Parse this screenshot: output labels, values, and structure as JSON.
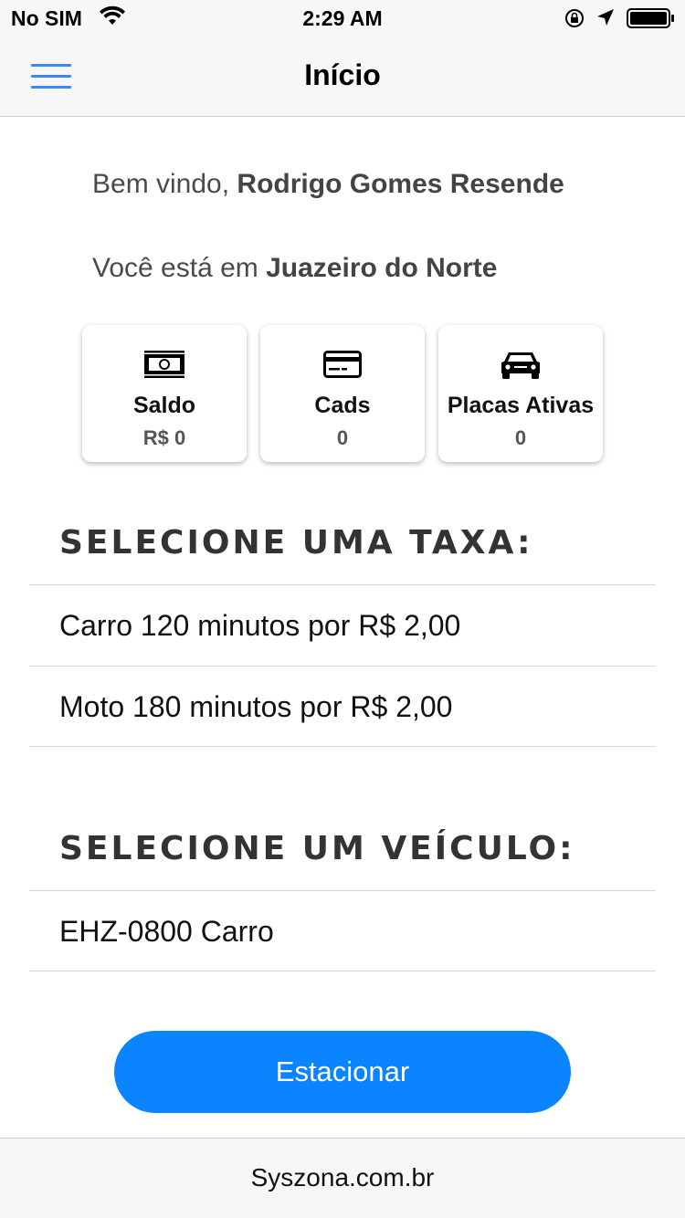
{
  "status_bar": {
    "carrier": "No SIM",
    "time": "2:29 AM"
  },
  "nav": {
    "title": "Início",
    "menu_icon": "hamburger-icon"
  },
  "welcome": {
    "greeting": "Bem vindo, ",
    "user_name": "Rodrigo Gomes Resende",
    "location_prefix": "Você está em ",
    "city": "Juazeiro do Norte"
  },
  "cards": [
    {
      "icon": "money-icon",
      "label": "Saldo",
      "value": "R$ 0"
    },
    {
      "icon": "credit-card-icon",
      "label": "Cads",
      "value": "0"
    },
    {
      "icon": "car-icon",
      "label": "Placas Ativas",
      "value": "0"
    }
  ],
  "rates": {
    "title": "SELECIONE UMA TAXA:",
    "items": [
      {
        "label": "Carro 120 minutos por R$ 2,00"
      },
      {
        "label": "Moto 180 minutos por R$ 2,00"
      }
    ]
  },
  "vehicles": {
    "title": "SELECIONE UM VEÍCULO:",
    "items": [
      {
        "label": "EHZ-0800 Carro"
      }
    ]
  },
  "park_button": {
    "label": "Estacionar"
  },
  "footer": {
    "text": "Syszona.com.br"
  },
  "colors": {
    "accent": "#0a84ff",
    "menu": "#3a86ff",
    "bar_background": "#f7f7f7"
  }
}
